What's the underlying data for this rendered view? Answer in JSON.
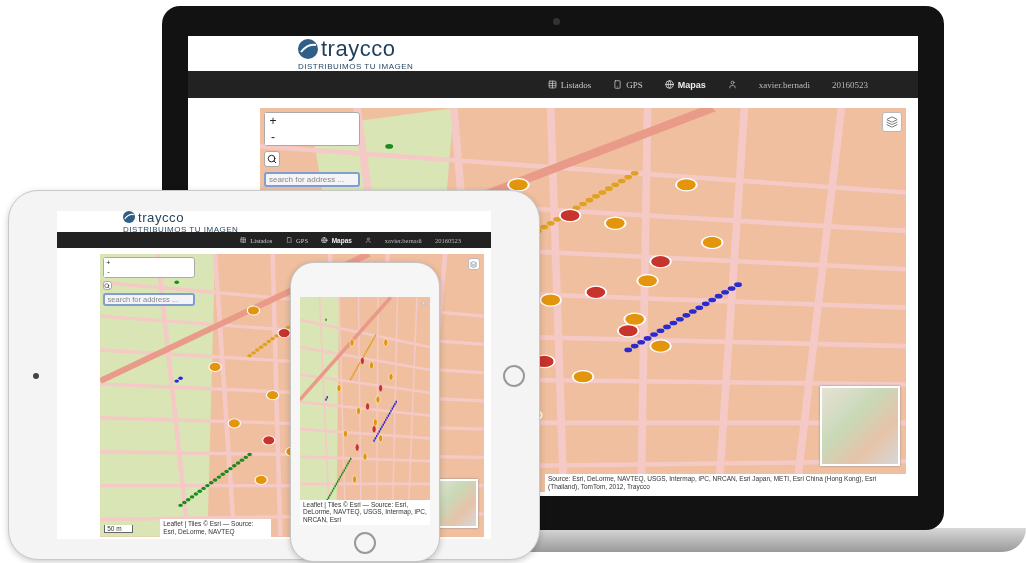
{
  "devices": [
    {
      "kind": "laptop",
      "screen": {
        "logo": "traycco",
        "tagline": "DISTRIBUIMOS TU IMAGEN",
        "nav": [
          {
            "label": "Listados",
            "selected": false
          },
          {
            "label": "GPS",
            "selected": false
          },
          {
            "label": "Mapas",
            "selected": true
          }
        ],
        "user": "xavier.bernadi",
        "code": "20160523",
        "zoom_in": "+",
        "zoom_out": "-",
        "search": {
          "placeholder": "search for address ..."
        },
        "attribution": "Source: Esri, DeLorme, NAVTEQ, USGS, Intermap, iPC, NRCAN, Esri Japan, METI, Esri China (Hong Kong), Esri (Thailand), TomTom, 2012, Traycco"
      }
    },
    {
      "kind": "tablet",
      "screen": {
        "logo": "traycco",
        "tagline": "DISTRIBUIMOS TU IMAGEN",
        "nav": [
          {
            "label": "Listados",
            "selected": false
          },
          {
            "label": "GPS",
            "selected": false
          },
          {
            "label": "Mapas",
            "selected": true
          }
        ],
        "user": "xavier.bernadi",
        "code": "20160523",
        "zoom_in": "+",
        "zoom_out": "-",
        "search": {
          "placeholder": "search for address ..."
        },
        "scale": "50 m",
        "attribution": "Leaflet | Tiles © Esri — Source: Esri, DeLorme, NAVTEQ"
      }
    },
    {
      "kind": "phone",
      "screen": {
        "attribution": "Leaflet | Tiles © Esri — Source: Esri, DeLorme, NAVTEQ, USGS, Intermap, iPC, NRCAN, Esri"
      }
    }
  ]
}
